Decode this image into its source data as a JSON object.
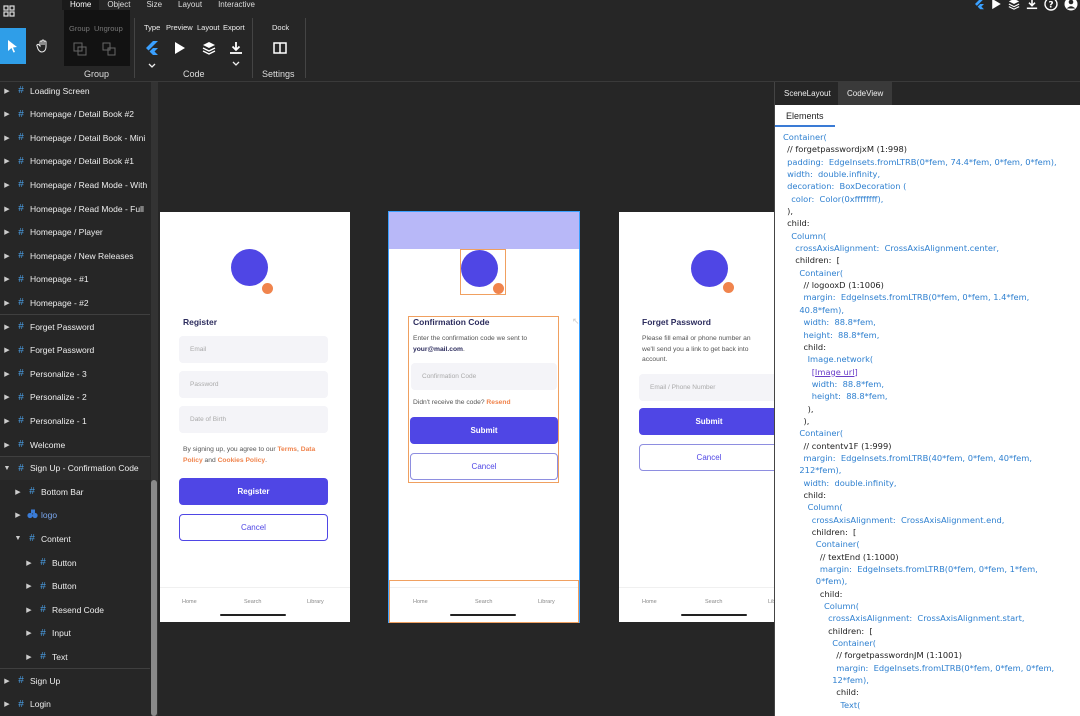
{
  "toolbar": {
    "menu_tabs": [
      "Home",
      "Object",
      "Size",
      "Layout",
      "Interactive"
    ],
    "group_label": "Group",
    "ungroup_label": "Ungroup",
    "group_section": "Group",
    "code_items": [
      "Type",
      "Preview",
      "Layout",
      "Export"
    ],
    "code_section": "Code",
    "dock_label": "Dock",
    "settings_section": "Settings",
    "icons": [
      "apps-icon",
      "pointer-icon",
      "hand-icon",
      "flutter-icon",
      "play-icon",
      "layers-icon",
      "download-icon",
      "dock-icon",
      "help-icon",
      "user-icon"
    ]
  },
  "layers": [
    {
      "label": "Loading Screen",
      "level": 0
    },
    {
      "label": "Homepage / Detail Book #2",
      "level": 0
    },
    {
      "label": "Homepage / Detail Book - Mini",
      "level": 0
    },
    {
      "label": "Homepage / Detail Book #1",
      "level": 0
    },
    {
      "label": "Homepage / Read Mode - With",
      "level": 0
    },
    {
      "label": "Homepage / Read Mode - Full",
      "level": 0
    },
    {
      "label": "Homepage / Player",
      "level": 0
    },
    {
      "label": "Homepage / New Releases",
      "level": 0
    },
    {
      "label": "Homepage - #1",
      "level": 0
    },
    {
      "label": "Homepage - #2",
      "level": 0
    },
    {
      "label": "Forget Password",
      "level": 0
    },
    {
      "label": "Forget Password",
      "level": 0
    },
    {
      "label": "Personalize - 3",
      "level": 0
    },
    {
      "label": "Personalize - 2",
      "level": 0
    },
    {
      "label": "Personalize - 1",
      "level": 0
    },
    {
      "label": "Welcome",
      "level": 0
    },
    {
      "label": "Sign Up - Confirmation Code",
      "level": 0
    },
    {
      "label": "Bottom Bar",
      "level": 1
    },
    {
      "label": "logo",
      "level": 1
    },
    {
      "label": "Content",
      "level": 1
    },
    {
      "label": "Button",
      "level": 2
    },
    {
      "label": "Button",
      "level": 2
    },
    {
      "label": "Resend Code",
      "level": 2
    },
    {
      "label": "Input",
      "level": 2
    },
    {
      "label": "Text",
      "level": 2
    },
    {
      "label": "Sign Up",
      "level": 0
    },
    {
      "label": "Login",
      "level": 0
    }
  ],
  "screens": {
    "register": {
      "title": "Register",
      "email_placeholder": "Email",
      "password_placeholder": "Password",
      "dob_placeholder": "Date of Birth",
      "terms_prefix": "By signing up, you agree to our ",
      "terms_link": "Terms",
      "comma": ", ",
      "data_policy": "Data Policy",
      "and": " and ",
      "cookies": "Cookies Policy",
      "period": ".",
      "register_button": "Register",
      "cancel_button": "Cancel"
    },
    "confirm": {
      "title": "Confirmation Code",
      "desc": "Enter the confirmation code we sent to",
      "email": "your@mail.com",
      "period": ".",
      "code_placeholder": "Confirmation Code",
      "no_code": "Didn't receive the code?",
      "resend": "Resend",
      "submit_button": "Submit",
      "cancel_button": "Cancel"
    },
    "forget": {
      "title": "Forget Password",
      "desc_line1": "Please fill email or phone number an",
      "desc_line2": "we'll send you a link to get back into",
      "desc_line3": "account.",
      "input_placeholder": "Email / Phone Number",
      "submit_button": "Submit",
      "cancel_button": "Cancel"
    },
    "tabbar": {
      "home": "Home",
      "search": "Search",
      "library": "Library"
    }
  },
  "panel": {
    "tab_scene": "SceneLayout",
    "tab_code": "CodeView",
    "elements_tab": "Elements"
  },
  "code_lines": [
    {
      "indent": 0,
      "text": "Container(",
      "kind": "cls"
    },
    {
      "indent": 1,
      "text": "// forgetpasswordjxM (1:998)",
      "kind": "cm"
    },
    {
      "indent": 1,
      "text": "padding:  EdgeInsets.fromLTRB(0*fem, 74.4*fem, 0*fem, 0*fem),",
      "kind": "cls"
    },
    {
      "indent": 1,
      "text": "width:  double.infinity,",
      "kind": "cls"
    },
    {
      "indent": 1,
      "text": "decoration:  BoxDecoration (",
      "kind": "cls"
    },
    {
      "indent": 2,
      "text": "color:  Color(0xffffffff),",
      "kind": "cls"
    },
    {
      "indent": 1,
      "text": "),",
      "kind": "cm"
    },
    {
      "indent": 1,
      "text": "child:",
      "kind": "cm"
    },
    {
      "indent": 2,
      "text": "Column(",
      "kind": "cls"
    },
    {
      "indent": 3,
      "text": "crossAxisAlignment:  CrossAxisAlignment.center,",
      "kind": "cls"
    },
    {
      "indent": 3,
      "text": "children:  [",
      "kind": "cm"
    },
    {
      "indent": 4,
      "text": "Container(",
      "kind": "cls"
    },
    {
      "indent": 5,
      "text": "// logooxD (1:1006)",
      "kind": "cm"
    },
    {
      "indent": 5,
      "text": "margin:  EdgeInsets.fromLTRB(0*fem, 0*fem, 1.4*fem,",
      "kind": "cls"
    },
    {
      "indent": 4,
      "text": "40.8*fem),",
      "kind": "cls"
    },
    {
      "indent": 5,
      "text": "width:  88.8*fem,",
      "kind": "cls"
    },
    {
      "indent": 5,
      "text": "height:  88.8*fem,",
      "kind": "cls"
    },
    {
      "indent": 5,
      "text": "child:",
      "kind": "cm"
    },
    {
      "indent": 6,
      "text": "Image.network(",
      "kind": "cls"
    },
    {
      "indent": 7,
      "text": "[Image url]",
      "kind": "link"
    },
    {
      "indent": 7,
      "text": "width:  88.8*fem,",
      "kind": "cls"
    },
    {
      "indent": 7,
      "text": "height:  88.8*fem,",
      "kind": "cls"
    },
    {
      "indent": 6,
      "text": "),",
      "kind": "cm"
    },
    {
      "indent": 5,
      "text": "),",
      "kind": "cm"
    },
    {
      "indent": 4,
      "text": "Container(",
      "kind": "cls"
    },
    {
      "indent": 5,
      "text": "// contentv1F (1:999)",
      "kind": "cm"
    },
    {
      "indent": 5,
      "text": "margin:  EdgeInsets.fromLTRB(40*fem, 0*fem, 40*fem,",
      "kind": "cls"
    },
    {
      "indent": 4,
      "text": "212*fem),",
      "kind": "cls"
    },
    {
      "indent": 5,
      "text": "width:  double.infinity,",
      "kind": "cls"
    },
    {
      "indent": 5,
      "text": "child:",
      "kind": "cm"
    },
    {
      "indent": 6,
      "text": "Column(",
      "kind": "cls"
    },
    {
      "indent": 7,
      "text": "crossAxisAlignment:  CrossAxisAlignment.end,",
      "kind": "cls"
    },
    {
      "indent": 7,
      "text": "children:  [",
      "kind": "cm"
    },
    {
      "indent": 8,
      "text": "Container(",
      "kind": "cls"
    },
    {
      "indent": 9,
      "text": "// textEnd (1:1000)",
      "kind": "cm"
    },
    {
      "indent": 9,
      "text": "margin:  EdgeInsets.fromLTRB(0*fem, 0*fem, 1*fem,",
      "kind": "cls"
    },
    {
      "indent": 8,
      "text": "0*fem),",
      "kind": "cls"
    },
    {
      "indent": 9,
      "text": "child:",
      "kind": "cm"
    },
    {
      "indent": 10,
      "text": "Column(",
      "kind": "cls"
    },
    {
      "indent": 11,
      "text": "crossAxisAlignment:  CrossAxisAlignment.start,",
      "kind": "cls"
    },
    {
      "indent": 11,
      "text": "children:  [",
      "kind": "cm"
    },
    {
      "indent": 12,
      "text": "Container(",
      "kind": "cls"
    },
    {
      "indent": 13,
      "text": "// forgetpasswordnJM (1:1001)",
      "kind": "cm"
    },
    {
      "indent": 13,
      "text": "margin:  EdgeInsets.fromLTRB(0*fem, 0*fem, 0*fem,",
      "kind": "cls"
    },
    {
      "indent": 12,
      "text": "12*fem),",
      "kind": "cls"
    },
    {
      "indent": 13,
      "text": "child:",
      "kind": "cm"
    },
    {
      "indent": 14,
      "text": "Text(",
      "kind": "cls"
    }
  ]
}
